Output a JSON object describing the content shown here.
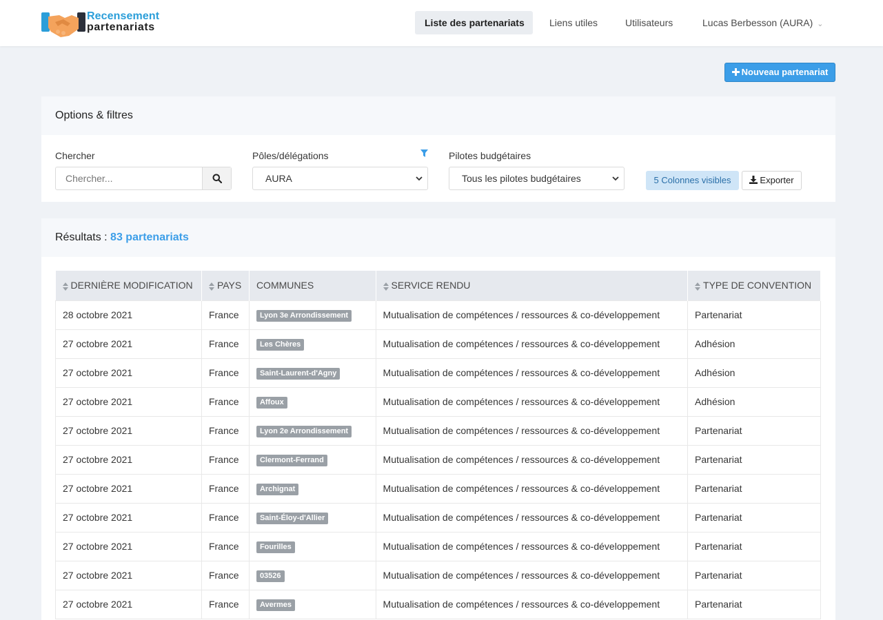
{
  "brand": {
    "line1": "Recensement",
    "line2": "partenariats"
  },
  "nav": {
    "items": [
      {
        "label": "Liste des partenariats",
        "active": true
      },
      {
        "label": "Liens utiles"
      },
      {
        "label": "Utilisateurs"
      }
    ],
    "user": "Lucas Berbesson (AURA)"
  },
  "actions": {
    "new_label": "Nouveau partenariat"
  },
  "filters": {
    "title": "Options & filtres",
    "search_label": "Chercher",
    "search_placeholder": "Chercher...",
    "pole_label": "Pôles/délégations",
    "pole_value": "AURA",
    "pilote_label": "Pilotes budgétaires",
    "pilote_value": "Tous les pilotes budgétaires",
    "columns_label": "5 Colonnes visibles",
    "export_label": "Exporter"
  },
  "results": {
    "prefix": "Résultats :",
    "count_label": "83 partenariats",
    "columns": [
      "Dernière modification",
      "Pays",
      "Communes",
      "Service rendu",
      "Type de convention"
    ],
    "rows": [
      {
        "date": "28 octobre 2021",
        "pays": "France",
        "commune": "Lyon 3e Arrondissement",
        "service": "Mutualisation de compétences / ressources & co-développement",
        "type": "Partenariat"
      },
      {
        "date": "27 octobre 2021",
        "pays": "France",
        "commune": "Les Chères",
        "service": "Mutualisation de compétences / ressources & co-développement",
        "type": "Adhésion"
      },
      {
        "date": "27 octobre 2021",
        "pays": "France",
        "commune": "Saint-Laurent-d'Agny",
        "service": "Mutualisation de compétences / ressources & co-développement",
        "type": "Adhésion"
      },
      {
        "date": "27 octobre 2021",
        "pays": "France",
        "commune": "Affoux",
        "service": "Mutualisation de compétences / ressources & co-développement",
        "type": "Adhésion"
      },
      {
        "date": "27 octobre 2021",
        "pays": "France",
        "commune": "Lyon 2e Arrondissement",
        "service": "Mutualisation de compétences / ressources & co-développement",
        "type": "Partenariat"
      },
      {
        "date": "27 octobre 2021",
        "pays": "France",
        "commune": "Clermont-Ferrand",
        "service": "Mutualisation de compétences / ressources & co-développement",
        "type": "Partenariat"
      },
      {
        "date": "27 octobre 2021",
        "pays": "France",
        "commune": "Archignat",
        "service": "Mutualisation de compétences / ressources & co-développement",
        "type": "Partenariat"
      },
      {
        "date": "27 octobre 2021",
        "pays": "France",
        "commune": "Saint-Éloy-d'Allier",
        "service": "Mutualisation de compétences / ressources & co-développement",
        "type": "Partenariat"
      },
      {
        "date": "27 octobre 2021",
        "pays": "France",
        "commune": "Fourilles",
        "service": "Mutualisation de compétences / ressources & co-développement",
        "type": "Partenariat"
      },
      {
        "date": "27 octobre 2021",
        "pays": "France",
        "commune": "03526",
        "service": "Mutualisation de compétences / ressources & co-développement",
        "type": "Partenariat"
      },
      {
        "date": "27 octobre 2021",
        "pays": "France",
        "commune": "Avermes",
        "service": "Mutualisation de compétences / ressources & co-développement",
        "type": "Partenariat"
      }
    ]
  },
  "colors": {
    "accent": "#3c9ee8",
    "tag": "#9aa0a6",
    "background": "#eff2f6"
  },
  "icons": [
    "handshake-logo-icon",
    "chevron-down-icon",
    "plus-icon",
    "search-icon",
    "filter-icon",
    "download-icon",
    "sort-icon"
  ]
}
